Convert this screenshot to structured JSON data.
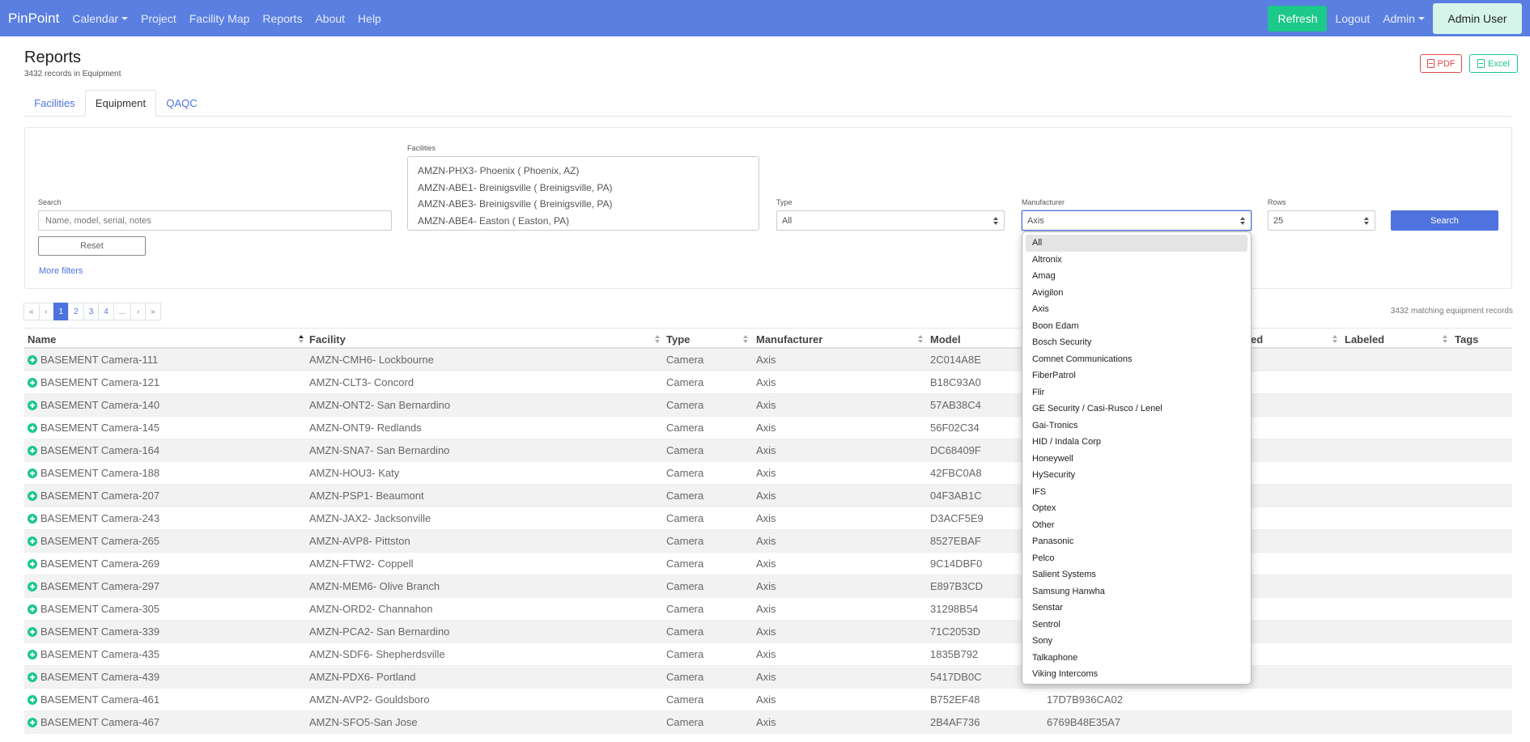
{
  "nav": {
    "brand": "PinPoint",
    "items": [
      "Calendar",
      "Project",
      "Facility Map",
      "Reports",
      "About",
      "Help"
    ],
    "refresh": "Refresh",
    "logout": "Logout",
    "admin": "Admin",
    "user": "Admin User"
  },
  "header": {
    "title": "Reports",
    "subtitle": "3432 records in Equipment",
    "pdf": "PDF",
    "excel": "Excel"
  },
  "tabs": [
    "Facilities",
    "Equipment",
    "QAQC"
  ],
  "filters": {
    "search_label": "Search",
    "search_placeholder": "Name, model, serial, notes",
    "reset": "Reset",
    "more_filters": "More filters",
    "facilities_label": "Facilities",
    "facilities": [
      "AMZN-PHX3- Phoenix ( Phoenix, AZ)",
      "AMZN-ABE1- Breinigsville ( Breinigsville, PA)",
      "AMZN-ABE3- Breinigsville ( Breinigsville, PA)",
      "AMZN-ABE4- Easton ( Easton, PA)"
    ],
    "type_label": "Type",
    "type_value": "All",
    "manufacturer_label": "Manufacturer",
    "manufacturer_value": "Axis",
    "rows_label": "Rows",
    "rows_value": "25",
    "search_button": "Search"
  },
  "manufacturer_options": [
    "All",
    "Altronix",
    "Amag",
    "Avigilon",
    "Axis",
    "Boon Edam",
    "Bosch Security",
    "Comnet Communications",
    "FiberPatrol",
    "Flir",
    "GE Security / Casi-Rusco / Lenel",
    "Gai-Tronics",
    "HID / Indala Corp",
    "Honeywell",
    "HySecurity",
    "IFS",
    "Optex",
    "Other",
    "Panasonic",
    "Pelco",
    "Salient Systems",
    "Samsung Hanwha",
    "Senstar",
    "Sentrol",
    "Sony",
    "Talkaphone",
    "Viking Intercoms"
  ],
  "pagination": [
    "«",
    "‹",
    "1",
    "2",
    "3",
    "4",
    "...",
    "›",
    "»"
  ],
  "matching": "3432 matching equipment records",
  "table": {
    "headers": [
      "Name",
      "Facility",
      "Type",
      "Manufacturer",
      "Model",
      "ed",
      "Labeled",
      "Tags"
    ],
    "rows": [
      [
        "BASEMENT Camera-111",
        "AMZN-CMH6- Lockbourne",
        "Camera",
        "Axis",
        "2C014A8E",
        ""
      ],
      [
        "BASEMENT Camera-121",
        "AMZN-CLT3- Concord",
        "Camera",
        "Axis",
        "B18C93A0",
        ""
      ],
      [
        "BASEMENT Camera-140",
        "AMZN-ONT2- San Bernardino",
        "Camera",
        "Axis",
        "57AB38C4",
        ""
      ],
      [
        "BASEMENT Camera-145",
        "AMZN-ONT9- Redlands",
        "Camera",
        "Axis",
        "56F02C34",
        ""
      ],
      [
        "BASEMENT Camera-164",
        "AMZN-SNA7- San Bernardino",
        "Camera",
        "Axis",
        "DC68409F",
        ""
      ],
      [
        "BASEMENT Camera-188",
        "AMZN-HOU3- Katy",
        "Camera",
        "Axis",
        "42FBC0A8",
        ""
      ],
      [
        "BASEMENT Camera-207",
        "AMZN-PSP1- Beaumont",
        "Camera",
        "Axis",
        "04F3AB1C",
        ""
      ],
      [
        "BASEMENT Camera-243",
        "AMZN-JAX2- Jacksonville",
        "Camera",
        "Axis",
        "D3ACF5E9",
        ""
      ],
      [
        "BASEMENT Camera-265",
        "AMZN-AVP8- Pittston",
        "Camera",
        "Axis",
        "8527EBAF",
        ""
      ],
      [
        "BASEMENT Camera-269",
        "AMZN-FTW2- Coppell",
        "Camera",
        "Axis",
        "9C14DBF0",
        ""
      ],
      [
        "BASEMENT Camera-297",
        "AMZN-MEM6- Olive Branch",
        "Camera",
        "Axis",
        "E897B3CD",
        ""
      ],
      [
        "BASEMENT Camera-305",
        "AMZN-ORD2- Channahon",
        "Camera",
        "Axis",
        "31298B54",
        ""
      ],
      [
        "BASEMENT Camera-339",
        "AMZN-PCA2- San Bernardino",
        "Camera",
        "Axis",
        "71C2053D",
        ""
      ],
      [
        "BASEMENT Camera-435",
        "AMZN-SDF6- Shepherdsville",
        "Camera",
        "Axis",
        "1835B792",
        ""
      ],
      [
        "BASEMENT Camera-439",
        "AMZN-PDX6- Portland",
        "Camera",
        "Axis",
        "5417DB0C",
        ""
      ],
      [
        "BASEMENT Camera-461",
        "AMZN-AVP2- Gouldsboro",
        "Camera",
        "Axis",
        "B752EF48",
        "17D7B936CA02"
      ],
      [
        "BASEMENT Camera-467",
        "AMZN-SFO5-San Jose",
        "Camera",
        "Axis",
        "2B4AF736",
        "6769B48E35A7"
      ]
    ]
  }
}
